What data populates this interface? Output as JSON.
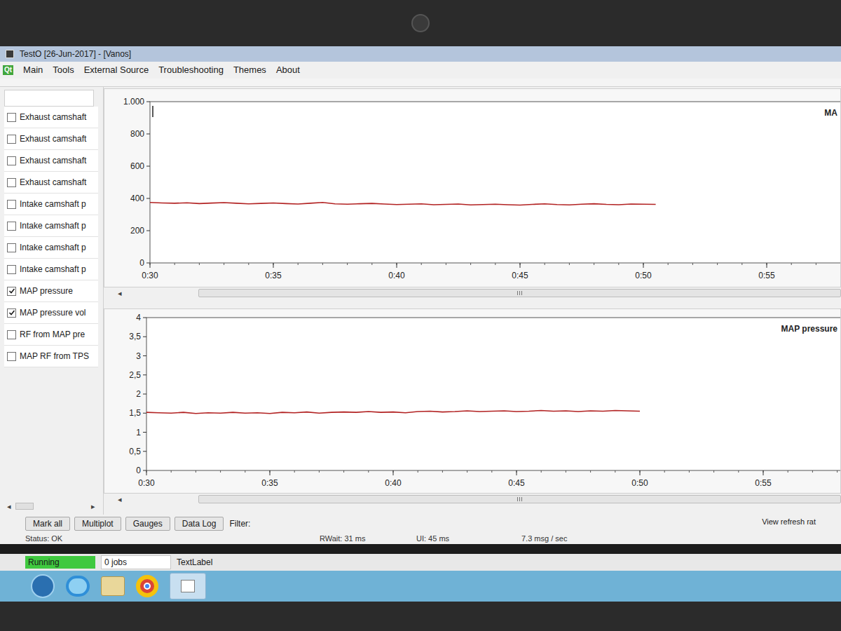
{
  "window": {
    "title": "TestO [26-Jun-2017] - [Vanos]"
  },
  "menu": {
    "icon": "Qt",
    "items": [
      "Main",
      "Tools",
      "External Source",
      "Troubleshooting",
      "Themes",
      "About"
    ]
  },
  "signals": [
    {
      "label": "Exhaust camshaft",
      "checked": false
    },
    {
      "label": "Exhaust camshaft",
      "checked": false
    },
    {
      "label": "Exhaust camshaft",
      "checked": false
    },
    {
      "label": "Exhaust camshaft",
      "checked": false
    },
    {
      "label": "Intake camshaft p",
      "checked": false
    },
    {
      "label": "Intake camshaft p",
      "checked": false
    },
    {
      "label": "Intake camshaft p",
      "checked": false
    },
    {
      "label": "Intake camshaft p",
      "checked": false
    },
    {
      "label": "MAP pressure",
      "checked": true
    },
    {
      "label": "MAP pressure vol",
      "checked": true
    },
    {
      "label": "RF from MAP pre",
      "checked": false
    },
    {
      "label": "MAP RF from TPS",
      "checked": false
    }
  ],
  "signal_scroll": {
    "left": "◂",
    "right": "▸"
  },
  "charts": [
    {
      "title": "MA",
      "scroll_arrow": "◂",
      "y_ticks": [
        "1.000",
        "800",
        "600",
        "400",
        "200",
        "0"
      ],
      "x_ticks": [
        "0:30",
        "0:35",
        "0:40",
        "0:45",
        "0:50",
        "0:55"
      ],
      "series": [
        {
          "name": "MAP pressure",
          "values": [
            375,
            372,
            370,
            373,
            368,
            371,
            374,
            370,
            366,
            369,
            372,
            368,
            365,
            370,
            375,
            366,
            364,
            367,
            369,
            365,
            362,
            364,
            366,
            361,
            363,
            365,
            360,
            362,
            364,
            361,
            359,
            363,
            366,
            362,
            360,
            364,
            367,
            363,
            361,
            365,
            364,
            363
          ]
        }
      ]
    },
    {
      "title": "MAP pressure",
      "scroll_arrow": "◂",
      "y_ticks": [
        "4",
        "3,5",
        "3",
        "2,5",
        "2",
        "1,5",
        "1",
        "0,5",
        "0"
      ],
      "x_ticks": [
        "0:30",
        "0:35",
        "0:40",
        "0:45",
        "0:50",
        "0:55"
      ],
      "series": [
        {
          "name": "MAP pressure voltage",
          "values": [
            1.52,
            1.51,
            1.5,
            1.52,
            1.49,
            1.51,
            1.5,
            1.52,
            1.5,
            1.51,
            1.49,
            1.52,
            1.51,
            1.53,
            1.5,
            1.52,
            1.53,
            1.52,
            1.54,
            1.52,
            1.53,
            1.51,
            1.54,
            1.55,
            1.53,
            1.54,
            1.56,
            1.54,
            1.55,
            1.56,
            1.54,
            1.55,
            1.57,
            1.55,
            1.56,
            1.54,
            1.56,
            1.55,
            1.57,
            1.56,
            1.55
          ]
        }
      ]
    }
  ],
  "toolbar": {
    "buttons": [
      "Mark all",
      "Multiplot",
      "Gauges",
      "Data Log"
    ],
    "filter_label": "Filter:",
    "refresh_label": "View refresh rat"
  },
  "status": {
    "status": "Status: OK",
    "rwait": "RWait:  31 ms",
    "ui": "UI:  45 ms",
    "rate": "7.3 msg / sec"
  },
  "footer": {
    "state": "Running",
    "jobs": "0 jobs",
    "label": "TextLabel"
  }
}
